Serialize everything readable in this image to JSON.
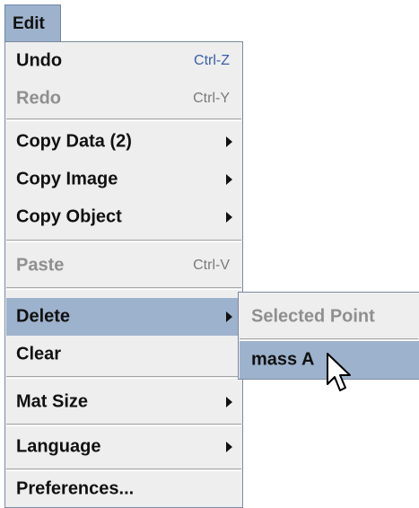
{
  "menubar": {
    "title": "Edit"
  },
  "menu": {
    "items": [
      {
        "label": "Undo",
        "accelerator": "Ctrl-Z",
        "enabled": true
      },
      {
        "label": "Redo",
        "accelerator": "Ctrl-Y",
        "enabled": false
      },
      {
        "label": "Copy Data (2)",
        "submenu": true,
        "enabled": true
      },
      {
        "label": "Copy Image",
        "submenu": true,
        "enabled": true
      },
      {
        "label": "Copy Object",
        "submenu": true,
        "enabled": true
      },
      {
        "label": "Paste",
        "accelerator": "Ctrl-V",
        "enabled": false
      },
      {
        "label": "Delete",
        "submenu": true,
        "enabled": true,
        "highlighted": true
      },
      {
        "label": "Clear",
        "enabled": true
      },
      {
        "label": "Mat Size",
        "submenu": true,
        "enabled": true
      },
      {
        "label": "Language",
        "submenu": true,
        "enabled": true
      },
      {
        "label": "Preferences...",
        "enabled": true
      }
    ]
  },
  "submenu": {
    "parent": "Delete",
    "items": [
      {
        "label": "Selected Point",
        "enabled": false
      },
      {
        "label": "mass A",
        "enabled": true,
        "highlighted": true
      }
    ]
  },
  "colors": {
    "highlight": "#9db2cc",
    "menu_background": "#eeeeee",
    "accelerator": "#3a5fa8",
    "disabled_text": "#8f8f8f"
  },
  "icons": {
    "submenu_indicator": "triangle-right-icon",
    "pointer": "arrow-cursor-icon"
  }
}
